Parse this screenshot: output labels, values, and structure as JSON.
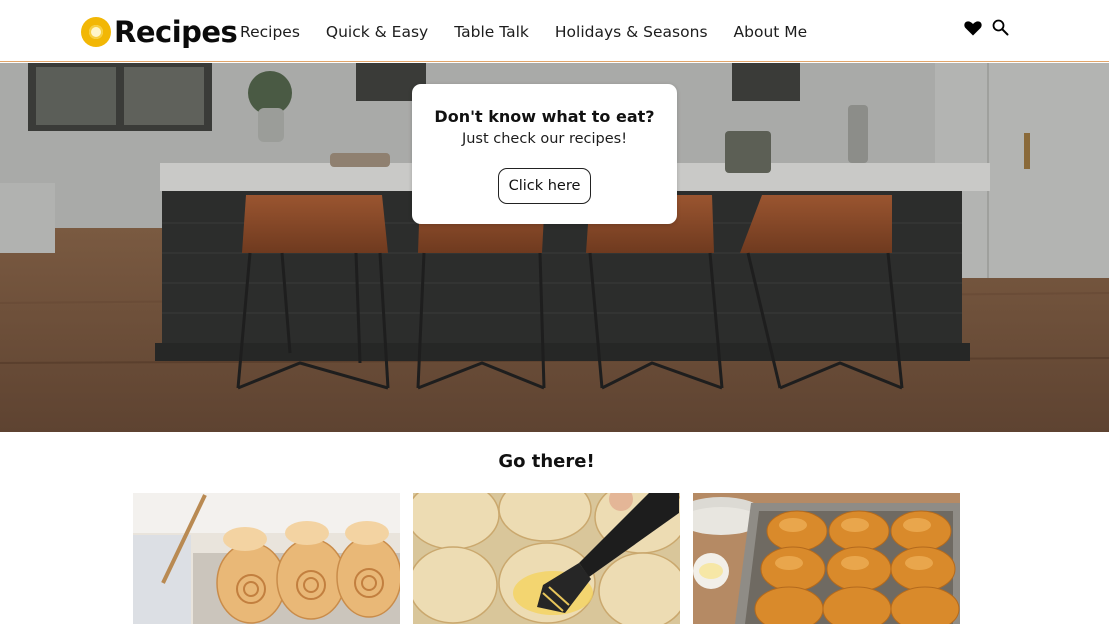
{
  "brand": {
    "name": "Recipes",
    "logo_icon": "yellow-ring-logo-icon",
    "accent_color": "#f2b705",
    "header_border_color": "#e2a66b"
  },
  "nav": {
    "items": [
      {
        "label": "Recipes"
      },
      {
        "label": "Quick & Easy"
      },
      {
        "label": "Table Talk"
      },
      {
        "label": "Holidays & Seasons"
      },
      {
        "label": "About Me"
      }
    ]
  },
  "header_icons": {
    "favorites": "heart-icon",
    "search": "magnifier-icon"
  },
  "hero": {
    "background": "kitchen-island-with-bar-stools-photo",
    "title": "Don't know what to eat?",
    "subtitle": "Just check our recipes!",
    "button_label": "Click here"
  },
  "section": {
    "title": "Go there!",
    "cards": [
      {
        "image": "swirl-bread-rolls-photo"
      },
      {
        "image": "butter-brushed-dough-rolls-photo"
      },
      {
        "image": "baked-dinner-rolls-pan-photo"
      }
    ]
  }
}
